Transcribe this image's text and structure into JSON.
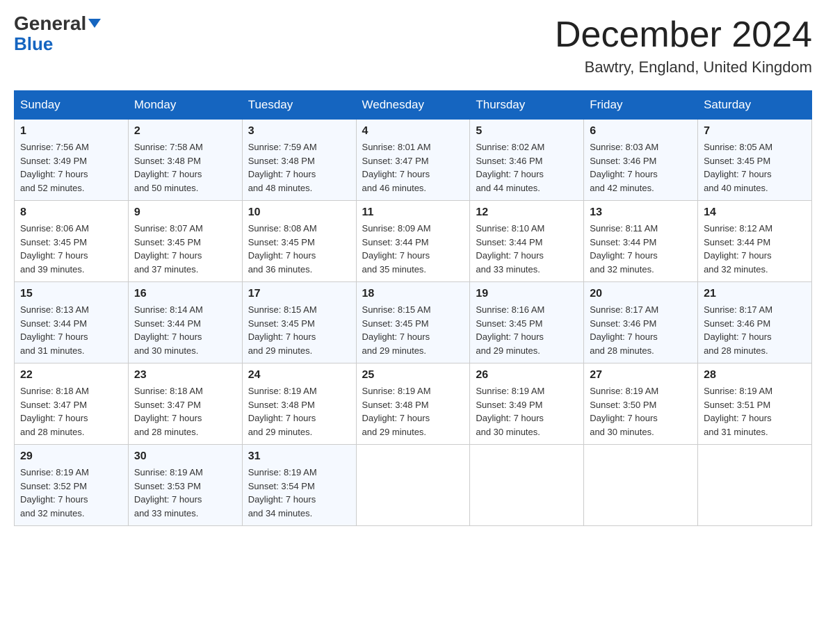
{
  "header": {
    "logo_line1": "General",
    "logo_line2": "Blue",
    "month_title": "December 2024",
    "location": "Bawtry, England, United Kingdom"
  },
  "days_of_week": [
    "Sunday",
    "Monday",
    "Tuesday",
    "Wednesday",
    "Thursday",
    "Friday",
    "Saturday"
  ],
  "weeks": [
    [
      {
        "day": "1",
        "sunrise": "7:56 AM",
        "sunset": "3:49 PM",
        "daylight": "7 hours and 52 minutes."
      },
      {
        "day": "2",
        "sunrise": "7:58 AM",
        "sunset": "3:48 PM",
        "daylight": "7 hours and 50 minutes."
      },
      {
        "day": "3",
        "sunrise": "7:59 AM",
        "sunset": "3:48 PM",
        "daylight": "7 hours and 48 minutes."
      },
      {
        "day": "4",
        "sunrise": "8:01 AM",
        "sunset": "3:47 PM",
        "daylight": "7 hours and 46 minutes."
      },
      {
        "day": "5",
        "sunrise": "8:02 AM",
        "sunset": "3:46 PM",
        "daylight": "7 hours and 44 minutes."
      },
      {
        "day": "6",
        "sunrise": "8:03 AM",
        "sunset": "3:46 PM",
        "daylight": "7 hours and 42 minutes."
      },
      {
        "day": "7",
        "sunrise": "8:05 AM",
        "sunset": "3:45 PM",
        "daylight": "7 hours and 40 minutes."
      }
    ],
    [
      {
        "day": "8",
        "sunrise": "8:06 AM",
        "sunset": "3:45 PM",
        "daylight": "7 hours and 39 minutes."
      },
      {
        "day": "9",
        "sunrise": "8:07 AM",
        "sunset": "3:45 PM",
        "daylight": "7 hours and 37 minutes."
      },
      {
        "day": "10",
        "sunrise": "8:08 AM",
        "sunset": "3:45 PM",
        "daylight": "7 hours and 36 minutes."
      },
      {
        "day": "11",
        "sunrise": "8:09 AM",
        "sunset": "3:44 PM",
        "daylight": "7 hours and 35 minutes."
      },
      {
        "day": "12",
        "sunrise": "8:10 AM",
        "sunset": "3:44 PM",
        "daylight": "7 hours and 33 minutes."
      },
      {
        "day": "13",
        "sunrise": "8:11 AM",
        "sunset": "3:44 PM",
        "daylight": "7 hours and 32 minutes."
      },
      {
        "day": "14",
        "sunrise": "8:12 AM",
        "sunset": "3:44 PM",
        "daylight": "7 hours and 32 minutes."
      }
    ],
    [
      {
        "day": "15",
        "sunrise": "8:13 AM",
        "sunset": "3:44 PM",
        "daylight": "7 hours and 31 minutes."
      },
      {
        "day": "16",
        "sunrise": "8:14 AM",
        "sunset": "3:44 PM",
        "daylight": "7 hours and 30 minutes."
      },
      {
        "day": "17",
        "sunrise": "8:15 AM",
        "sunset": "3:45 PM",
        "daylight": "7 hours and 29 minutes."
      },
      {
        "day": "18",
        "sunrise": "8:15 AM",
        "sunset": "3:45 PM",
        "daylight": "7 hours and 29 minutes."
      },
      {
        "day": "19",
        "sunrise": "8:16 AM",
        "sunset": "3:45 PM",
        "daylight": "7 hours and 29 minutes."
      },
      {
        "day": "20",
        "sunrise": "8:17 AM",
        "sunset": "3:46 PM",
        "daylight": "7 hours and 28 minutes."
      },
      {
        "day": "21",
        "sunrise": "8:17 AM",
        "sunset": "3:46 PM",
        "daylight": "7 hours and 28 minutes."
      }
    ],
    [
      {
        "day": "22",
        "sunrise": "8:18 AM",
        "sunset": "3:47 PM",
        "daylight": "7 hours and 28 minutes."
      },
      {
        "day": "23",
        "sunrise": "8:18 AM",
        "sunset": "3:47 PM",
        "daylight": "7 hours and 28 minutes."
      },
      {
        "day": "24",
        "sunrise": "8:19 AM",
        "sunset": "3:48 PM",
        "daylight": "7 hours and 29 minutes."
      },
      {
        "day": "25",
        "sunrise": "8:19 AM",
        "sunset": "3:48 PM",
        "daylight": "7 hours and 29 minutes."
      },
      {
        "day": "26",
        "sunrise": "8:19 AM",
        "sunset": "3:49 PM",
        "daylight": "7 hours and 30 minutes."
      },
      {
        "day": "27",
        "sunrise": "8:19 AM",
        "sunset": "3:50 PM",
        "daylight": "7 hours and 30 minutes."
      },
      {
        "day": "28",
        "sunrise": "8:19 AM",
        "sunset": "3:51 PM",
        "daylight": "7 hours and 31 minutes."
      }
    ],
    [
      {
        "day": "29",
        "sunrise": "8:19 AM",
        "sunset": "3:52 PM",
        "daylight": "7 hours and 32 minutes."
      },
      {
        "day": "30",
        "sunrise": "8:19 AM",
        "sunset": "3:53 PM",
        "daylight": "7 hours and 33 minutes."
      },
      {
        "day": "31",
        "sunrise": "8:19 AM",
        "sunset": "3:54 PM",
        "daylight": "7 hours and 34 minutes."
      },
      null,
      null,
      null,
      null
    ]
  ],
  "labels": {
    "sunrise": "Sunrise:",
    "sunset": "Sunset:",
    "daylight": "Daylight:"
  }
}
